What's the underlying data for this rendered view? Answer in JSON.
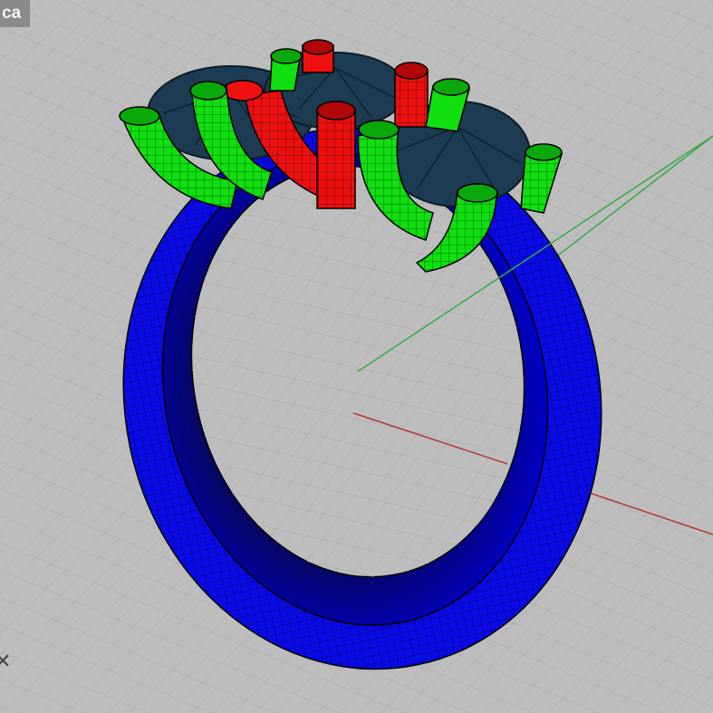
{
  "viewport": {
    "label": "ca",
    "axis_icon": "x-axis-marker-icon"
  },
  "colors": {
    "background": "#bdbdbd",
    "grid_line": "#a8a8a8",
    "x_axis": "#b03a3a",
    "y_axis": "#3aa84a",
    "band": "#0a0ae8",
    "band_shadow": "#05054a",
    "prong_green": "#10e010",
    "prong_red": "#ee1010",
    "gem": "#1d3b52"
  }
}
